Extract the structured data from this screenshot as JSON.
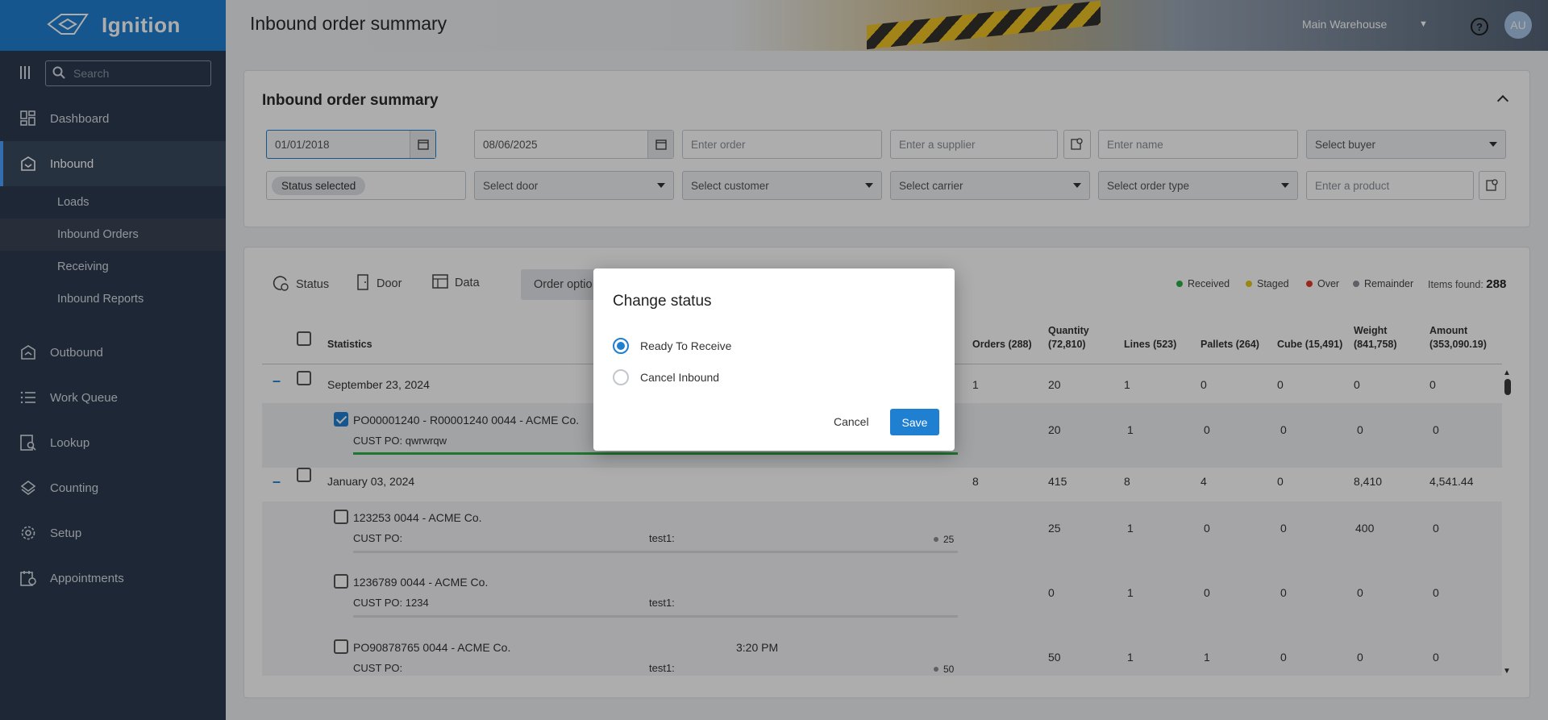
{
  "app": {
    "name": "Ignition",
    "header_title": "Inbound order summary",
    "warehouse": "Main Warehouse",
    "avatar_initials": "AU"
  },
  "sidebar": {
    "search_placeholder": "Search",
    "items": [
      {
        "label": "Dashboard",
        "icon": "dashboard-icon"
      },
      {
        "label": "Inbound",
        "icon": "inbound-icon",
        "active": true
      },
      {
        "label": "Outbound",
        "icon": "outbound-icon"
      },
      {
        "label": "Work Queue",
        "icon": "list-icon"
      },
      {
        "label": "Lookup",
        "icon": "lookup-icon"
      },
      {
        "label": "Counting",
        "icon": "counting-icon"
      },
      {
        "label": "Setup",
        "icon": "gear-icon"
      },
      {
        "label": "Appointments",
        "icon": "calendar-icon"
      }
    ],
    "inbound_sub": [
      {
        "label": "Loads"
      },
      {
        "label": "Inbound Orders",
        "active": true
      },
      {
        "label": "Receiving"
      },
      {
        "label": "Inbound Reports"
      }
    ]
  },
  "filters": {
    "title": "Inbound order summary",
    "date_from": "01/01/2018",
    "date_to": "08/06/2025",
    "order_placeholder": "Enter order",
    "supplier_placeholder": "Enter a supplier",
    "name_placeholder": "Enter name",
    "buyer_placeholder": "Select buyer",
    "status_chip": "Status selected",
    "door_placeholder": "Select door",
    "customer_placeholder": "Select customer",
    "carrier_placeholder": "Select carrier",
    "order_type_placeholder": "Select order type",
    "product_placeholder": "Enter a product"
  },
  "toolbar": {
    "status": "Status",
    "door": "Door",
    "data": "Data",
    "order_options": "Order optio"
  },
  "legend": {
    "received": "Received",
    "staged": "Staged",
    "over": "Over",
    "remainder": "Remainder",
    "items_found_label": "Items found:",
    "items_found_value": "288",
    "colors": {
      "received": "#2eae48",
      "staged": "#e8c51a",
      "over": "#e03b2f",
      "remainder": "#8a8f97"
    }
  },
  "table": {
    "headers": {
      "statistics": "Statistics",
      "orders": "Orders (288)",
      "quantity": "Quantity",
      "quantity_total": "(72,810)",
      "lines": "Lines (523)",
      "pallets": "Pallets (264)",
      "cube": "Cube (15,491)",
      "weight": "Weight",
      "weight_total": "(841,758)",
      "amount": "Amount",
      "amount_total": "(353,090.19)"
    },
    "group1": {
      "date": "September 23, 2024",
      "orders": "1",
      "quantity": "20",
      "lines": "1",
      "pallets": "0",
      "cube": "0",
      "weight": "0",
      "amount": "0"
    },
    "row1": {
      "title": "PO00001240 - R00001240 0044 - ACME Co.",
      "cust_po": "CUST PO: qwrwrqw",
      "quantity": "20",
      "lines": "1",
      "pallets": "0",
      "cube": "0",
      "weight": "0",
      "amount": "0",
      "progress": 1.0
    },
    "group2": {
      "date": "January 03, 2024",
      "orders": "8",
      "quantity": "415",
      "lines": "8",
      "pallets": "4",
      "cube": "0",
      "weight": "8,410",
      "amount": "4,541.44"
    },
    "row2": {
      "title": "123253 0044 - ACME Co.",
      "cust_po": "CUST PO:",
      "test": "test1:",
      "remainder": "25",
      "quantity": "25",
      "lines": "1",
      "pallets": "0",
      "cube": "0",
      "weight": "400",
      "amount": "0"
    },
    "row3": {
      "title": "1236789 0044 - ACME Co.",
      "cust_po": "CUST PO: 1234",
      "test": "test1:",
      "quantity": "0",
      "lines": "1",
      "pallets": "0",
      "cube": "0",
      "weight": "0",
      "amount": "0"
    },
    "row4": {
      "title": "PO90878765 0044 - ACME Co.",
      "time": "3:20 PM",
      "cust_po": "CUST PO:",
      "test": "test1:",
      "remainder": "50",
      "quantity": "50",
      "lines": "1",
      "pallets": "1",
      "cube": "0",
      "weight": "0",
      "amount": "0"
    }
  },
  "modal": {
    "title": "Change status",
    "option1": "Ready To Receive",
    "option2": "Cancel Inbound",
    "selected": "option1",
    "cancel": "Cancel",
    "save": "Save"
  }
}
